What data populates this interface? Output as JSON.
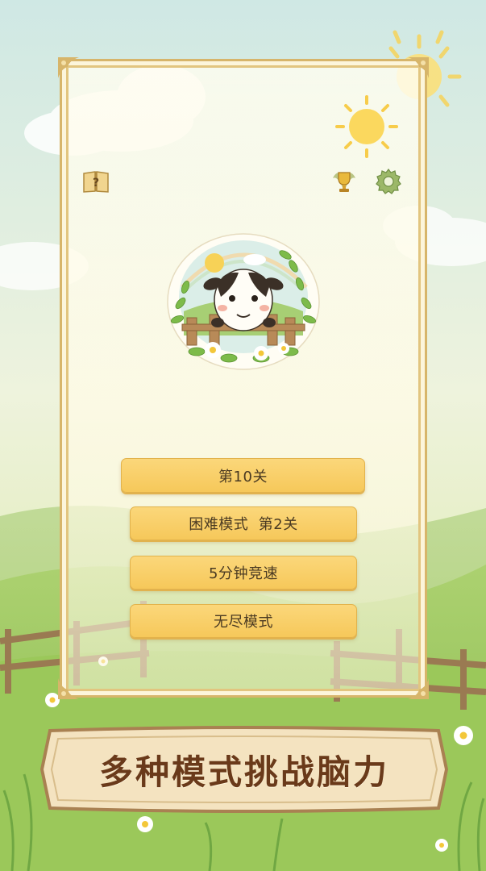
{
  "menu": {
    "items": [
      {
        "label": "第10关"
      },
      {
        "label": "困难模式  第2关"
      },
      {
        "label": "5分钟竞速"
      },
      {
        "label": "无尽模式"
      }
    ]
  },
  "banner": {
    "text": "多种模式挑战脑力"
  },
  "top_icons": {
    "left": "help-book-icon",
    "right": [
      "trophy-icon",
      "settings-gear-icon"
    ]
  },
  "colors": {
    "button_fill": "#f6c85a",
    "button_text": "#4a3a22",
    "frame_gold": "#d7b56a",
    "banner_text": "#6a3a1a",
    "sky": "#dcefe9",
    "grass": "#a8cf6a"
  }
}
